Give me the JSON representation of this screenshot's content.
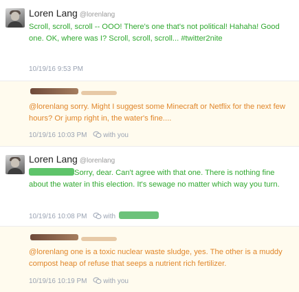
{
  "tweets": [
    {
      "name": "Loren Lang",
      "handle": "@lorenlang",
      "text": "Scroll, scroll, scroll -- OOO!  There's one that's not political! Hahaha! Good one. OK, where was I? Scroll, scroll, scroll... #twitter2nite",
      "timestamp": "10/19/16 9:53 PM"
    },
    {
      "text": "@lorenlang sorry.  Might I suggest some Minecraft or Netflix for the next few hours?  Or jump right in, the water's fine....",
      "timestamp": "10/19/16 10:03 PM",
      "with_label": "with you"
    },
    {
      "name": "Loren Lang",
      "handle": "@lorenlang",
      "text": "Sorry, dear. Can't agree with that one. There is nothing fine about the water in this election. It's sewage no matter which way you turn.",
      "timestamp": "10/19/16 10:08 PM",
      "with_label": "with"
    },
    {
      "text": "@lorenlang one is a toxic nuclear waste sludge, yes. The other is a muddy compost heap of refuse that seeps a nutrient rich fertilizer.",
      "timestamp": "10/19/16 10:19 PM",
      "with_label": "with you"
    }
  ],
  "icons": {
    "conversation": "conversation-icon",
    "avatar": "avatar-icon"
  },
  "colors": {
    "own_text": "#2fa82f",
    "reply_text": "#e0862a",
    "reply_background": "#fffbee",
    "timestamp": "#9aa3b3"
  }
}
